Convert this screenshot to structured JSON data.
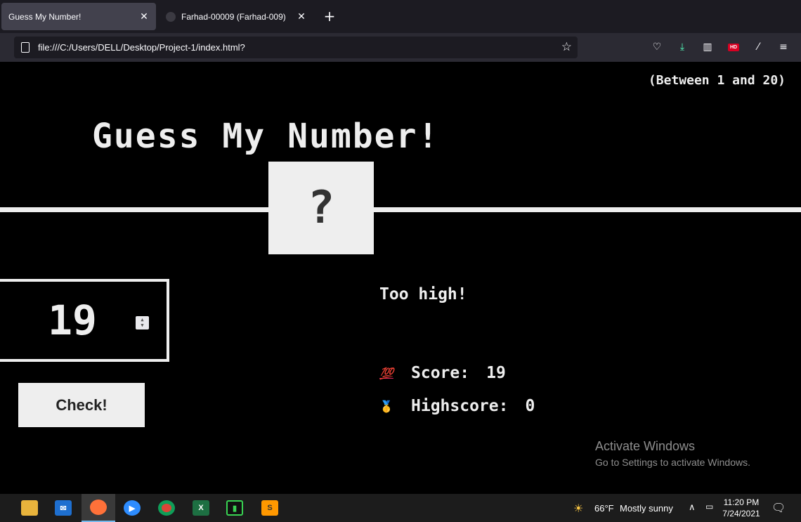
{
  "browser": {
    "tabs": [
      {
        "title": "Guess My Number!",
        "active": true
      },
      {
        "title": "Farhad-00009 (Farhad-009)",
        "active": false
      }
    ],
    "url": "file:///C:/Users/DELL/Desktop/Project-1/index.html?",
    "hd_badge": "HD"
  },
  "game": {
    "between": "(Between 1 and 20)",
    "title": "Guess My Number!",
    "secret": "?",
    "guess_value": "19",
    "check_label": "Check!",
    "message": "Too high!",
    "score_label": "Score:",
    "score_value": "19",
    "highscore_label": "Highscore:",
    "highscore_value": "0",
    "score_icon": "💯",
    "highscore_icon": "🥇"
  },
  "watermark": {
    "line1": "Activate Windows",
    "line2": "Go to Settings to activate Windows."
  },
  "taskbar": {
    "apps": [
      "file-explorer",
      "mail",
      "firefox",
      "zoom",
      "chrome",
      "excel",
      "terminal",
      "sublime-text"
    ],
    "weather_temp": "66°F",
    "weather_text": "Mostly sunny",
    "time": "11:20 PM",
    "date": "7/24/2021"
  }
}
